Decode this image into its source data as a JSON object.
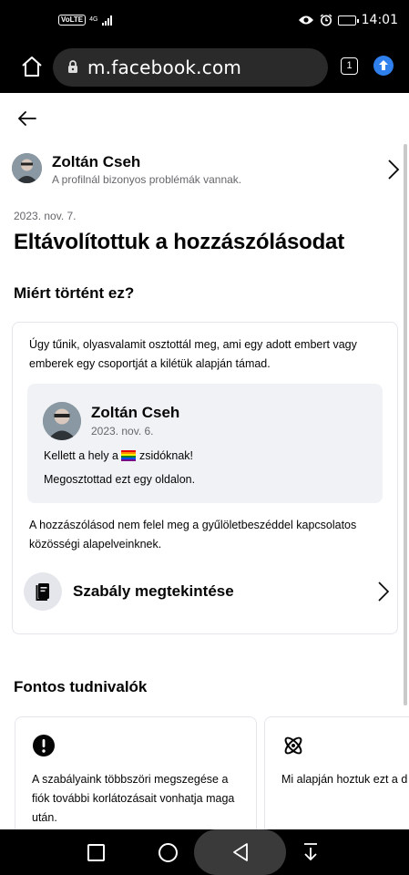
{
  "status_bar": {
    "volte": "VoLTE",
    "network": "4G",
    "time": "14:01",
    "battery_level": 0.85
  },
  "browser": {
    "url": "m.facebook.com",
    "tab_count": "1"
  },
  "profile": {
    "name": "Zoltán Cseh",
    "subtitle": "A profilnál bizonyos problémák vannak."
  },
  "notice": {
    "date": "2023. nov. 7.",
    "title": "Eltávolítottuk a hozzászólásodat",
    "why_heading": "Miért történt ez?",
    "explanation": "Úgy tűnik, olyasvalamit osztottál meg, ami egy adott embert vagy emberek egy csoportját a kilétük alapján támad.",
    "post": {
      "author": "Zoltán Cseh",
      "date": "2023. nov. 6.",
      "text_before": "Kellett a hely a",
      "text_after": "zsidóknak!",
      "shared_where": "Megosztottad ezt egy oldalon."
    },
    "policy_text": "A hozzászólásod nem felel meg a gyűlöletbeszéddel kapcsolatos közösségi alapelveinknek.",
    "view_rule_label": "Szabály megtekintése"
  },
  "important": {
    "heading": "Fontos tudnivalók",
    "cards": [
      {
        "icon": "exclamation-icon",
        "text": "A szabályaink többszöri megszegése a fiók további korlátozásait vonhatja maga után."
      },
      {
        "icon": "atom-icon",
        "text": "Mi alapján hoztuk ezt a d"
      }
    ]
  },
  "colors": {
    "text_primary": "#050505",
    "text_secondary": "#65676b",
    "card_border": "#e4e6eb",
    "quote_bg": "#f0f2f5",
    "browser_accent": "#2f80ed"
  }
}
